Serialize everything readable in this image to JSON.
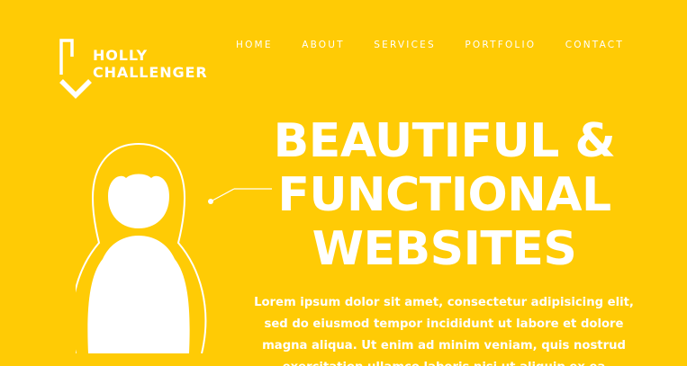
{
  "brand": {
    "line1": "HOLLY",
    "line2": "CHALLENGER",
    "logo_icon": "angle-bracket-logo-icon"
  },
  "nav": {
    "items": [
      {
        "label": "HOME"
      },
      {
        "label": "ABOUT"
      },
      {
        "label": "SERVICES"
      },
      {
        "label": "PORTFOLIO"
      },
      {
        "label": "CONTACT"
      }
    ]
  },
  "hero": {
    "headline_line1": "BEAUTIFUL &",
    "headline_line2": "FUNCTIONAL",
    "headline_line3": "WEBSITES",
    "body": "Lorem ipsum dolor sit amet, consectetur adipisicing elit, sed do eiusmod tempor incididunt ut labore et dolore magna aliqua. Ut enim ad minim veniam, quis nostrud exercitation ullamco laboris nisi ut aliquip ex ea commodo consequat.",
    "illustration_icon": "nesting-doll-icon"
  },
  "colors": {
    "background": "#FFCB05",
    "foreground": "#FFFFFF"
  }
}
